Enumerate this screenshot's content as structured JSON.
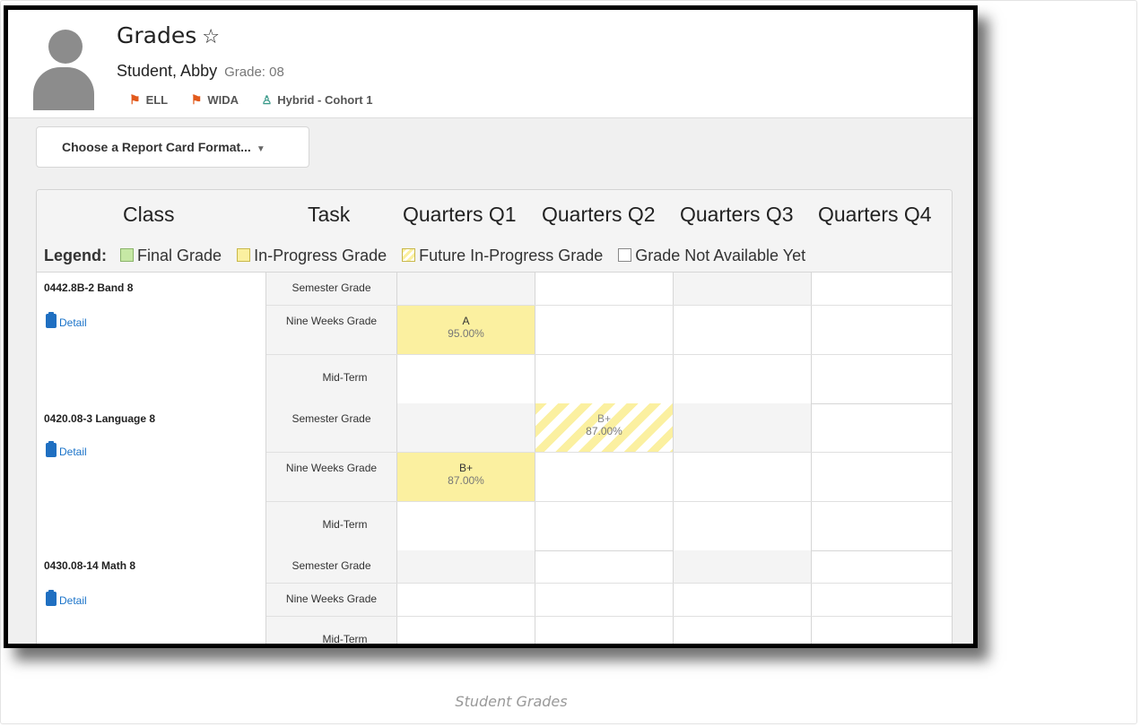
{
  "page": {
    "title": "Grades",
    "star_icon": "☆",
    "caption": "Student Grades"
  },
  "student": {
    "name": "Student, Abby",
    "grade_label": "Grade: 08",
    "flags": [
      {
        "label": "ELL",
        "icon": "flag-icon"
      },
      {
        "label": "WIDA",
        "icon": "flag-icon"
      },
      {
        "label": "Hybrid - Cohort 1",
        "icon": "person-icon"
      }
    ]
  },
  "format_select": {
    "label": "Choose a Report Card Format...",
    "caret": "▼"
  },
  "columns": {
    "class": "Class",
    "task": "Task",
    "q1": "Quarters Q1",
    "q2": "Quarters Q2",
    "q3": "Quarters Q3",
    "q4": "Quarters Q4"
  },
  "legend": {
    "title": "Legend:",
    "final": "Final Grade",
    "in_progress": "In-Progress Grade",
    "future": "Future In-Progress Grade",
    "not_available": "Grade Not Available Yet",
    "colors": {
      "final": "#c6e8a5",
      "in_progress": "#fbf0a0"
    }
  },
  "detail_label": "Detail",
  "classes": [
    {
      "name": "0442.8B-2 Band 8",
      "tasks": [
        {
          "label": "Semester Grade",
          "cells": [
            "",
            "",
            "",
            ""
          ]
        },
        {
          "label": "Nine Weeks Grade",
          "cells": [
            {
              "grade": "A",
              "percent": "95.00%"
            },
            "",
            "",
            ""
          ]
        },
        {
          "label": "Mid-Term",
          "cells": [
            "",
            "",
            "",
            ""
          ]
        }
      ]
    },
    {
      "name": "0420.08-3 Language 8",
      "tasks": [
        {
          "label": "Semester Grade",
          "cells": [
            "",
            {
              "grade": "B+",
              "percent": "87.00%"
            },
            "",
            ""
          ]
        },
        {
          "label": "Nine Weeks Grade",
          "cells": [
            {
              "grade": "B+",
              "percent": "87.00%"
            },
            "",
            "",
            ""
          ]
        },
        {
          "label": "Mid-Term",
          "cells": [
            "",
            "",
            "",
            ""
          ]
        }
      ]
    },
    {
      "name": "0430.08-14 Math 8",
      "tasks": [
        {
          "label": "Semester Grade",
          "cells": [
            "",
            "",
            "",
            ""
          ]
        },
        {
          "label": "Nine Weeks Grade",
          "cells": [
            "",
            "",
            "",
            ""
          ]
        },
        {
          "label": "Mid-Term",
          "cells": [
            "",
            "",
            "",
            ""
          ]
        }
      ]
    }
  ]
}
